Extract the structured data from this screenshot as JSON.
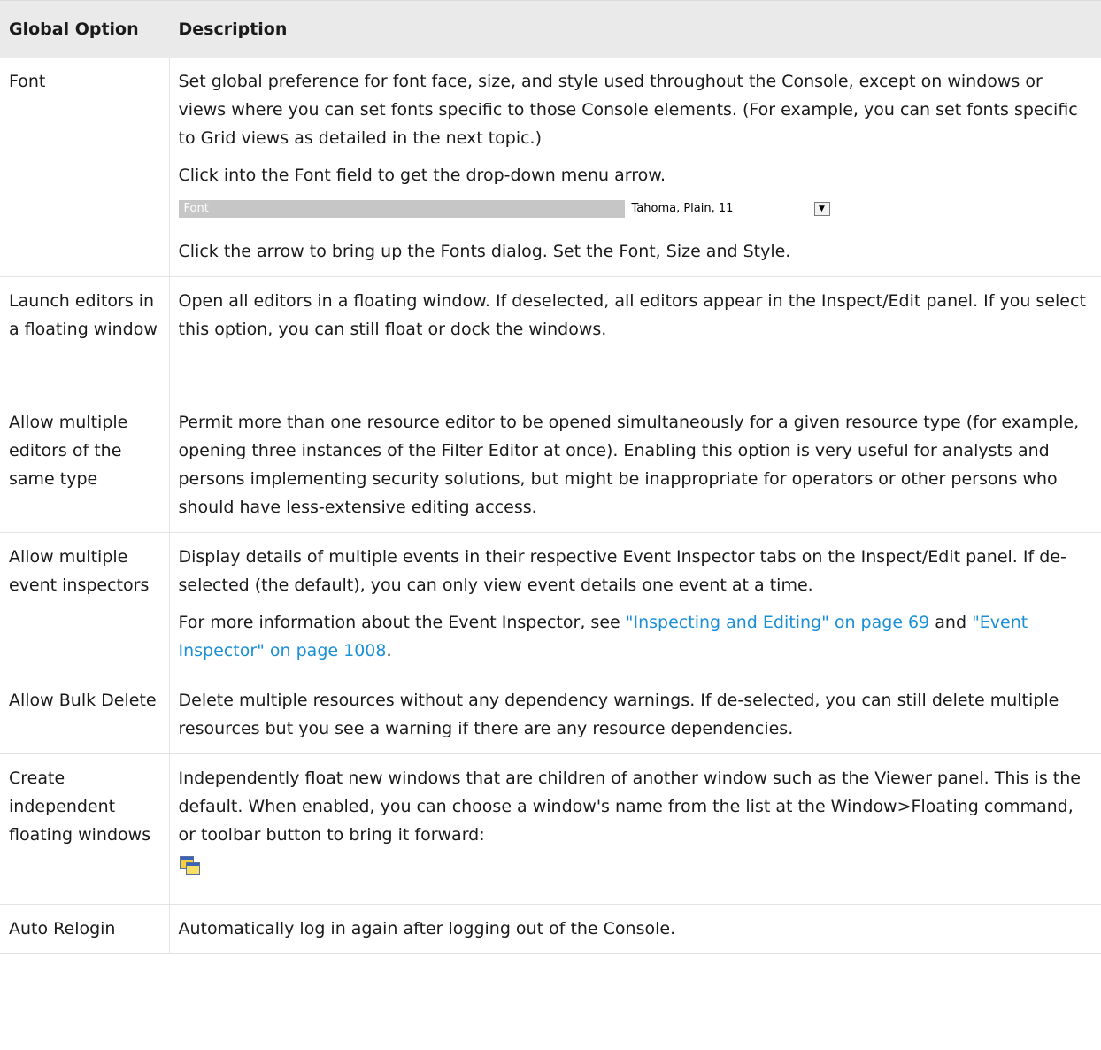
{
  "header": {
    "col1": "Global Option",
    "col2": "Description"
  },
  "rows": {
    "font": {
      "name": "Font",
      "p1": "Set global preference for font face, size, and style used throughout the Console, except on windows or views where you can set fonts specific to those Console elements. (For example, you can set fonts specific to Grid views as detailed in the next topic.)",
      "p2": "Click into the Font field to get the drop-down menu arrow.",
      "field_label": "Font",
      "field_value": "Tahoma, Plain, 11",
      "p3": "Click the arrow to bring up the Fonts dialog. Set the Font, Size and Style."
    },
    "launch": {
      "name": "Launch editors in a floating window",
      "p1": "Open all editors in a floating window. If deselected, all editors appear in the Inspect/Edit panel. If you select this option, you can still float or dock the windows."
    },
    "multi_editors": {
      "name": "Allow multiple editors of the same type",
      "p1": "Permit more than one resource editor to be opened simultaneously for a given resource type (for example, opening three instances of the Filter Editor at once). Enabling this option is very useful for analysts and persons implementing security solutions, but might be inappropriate for operators or other persons who should have less-extensive editing access."
    },
    "multi_inspectors": {
      "name": "Allow multiple event inspectors",
      "p1": "Display details of multiple events in their respective Event Inspector tabs on the Inspect/Edit panel. If de-selected (the default), you can only view event details one event at a time.",
      "p2_prefix": "For more information about the Event Inspector, see ",
      "link1": "\"Inspecting and Editing\" on page 69",
      "p2_mid": " and ",
      "link2": "\"Event Inspector\" on page 1008",
      "p2_suffix": "."
    },
    "bulk_delete": {
      "name": "Allow Bulk Delete",
      "p1": "Delete multiple resources without any dependency warnings. If de-selected, you can still delete multiple resources but you see a warning if there are any resource dependencies."
    },
    "independent": {
      "name": "Create independent floating windows",
      "p1": "Independently float new windows that are children of another window such as the Viewer panel. This is the default. When enabled, you can choose a window's name from the list at the Window>Floating command, or toolbar button to bring it forward:",
      "icon": "floating-windows-icon"
    },
    "relogin": {
      "name": "Auto Relogin",
      "p1": "Automatically log in again after logging out of the Console."
    }
  },
  "colors": {
    "header_bg": "#eaeaea",
    "link": "#1a8fd6",
    "field_label_bg": "#c6c6c6"
  }
}
